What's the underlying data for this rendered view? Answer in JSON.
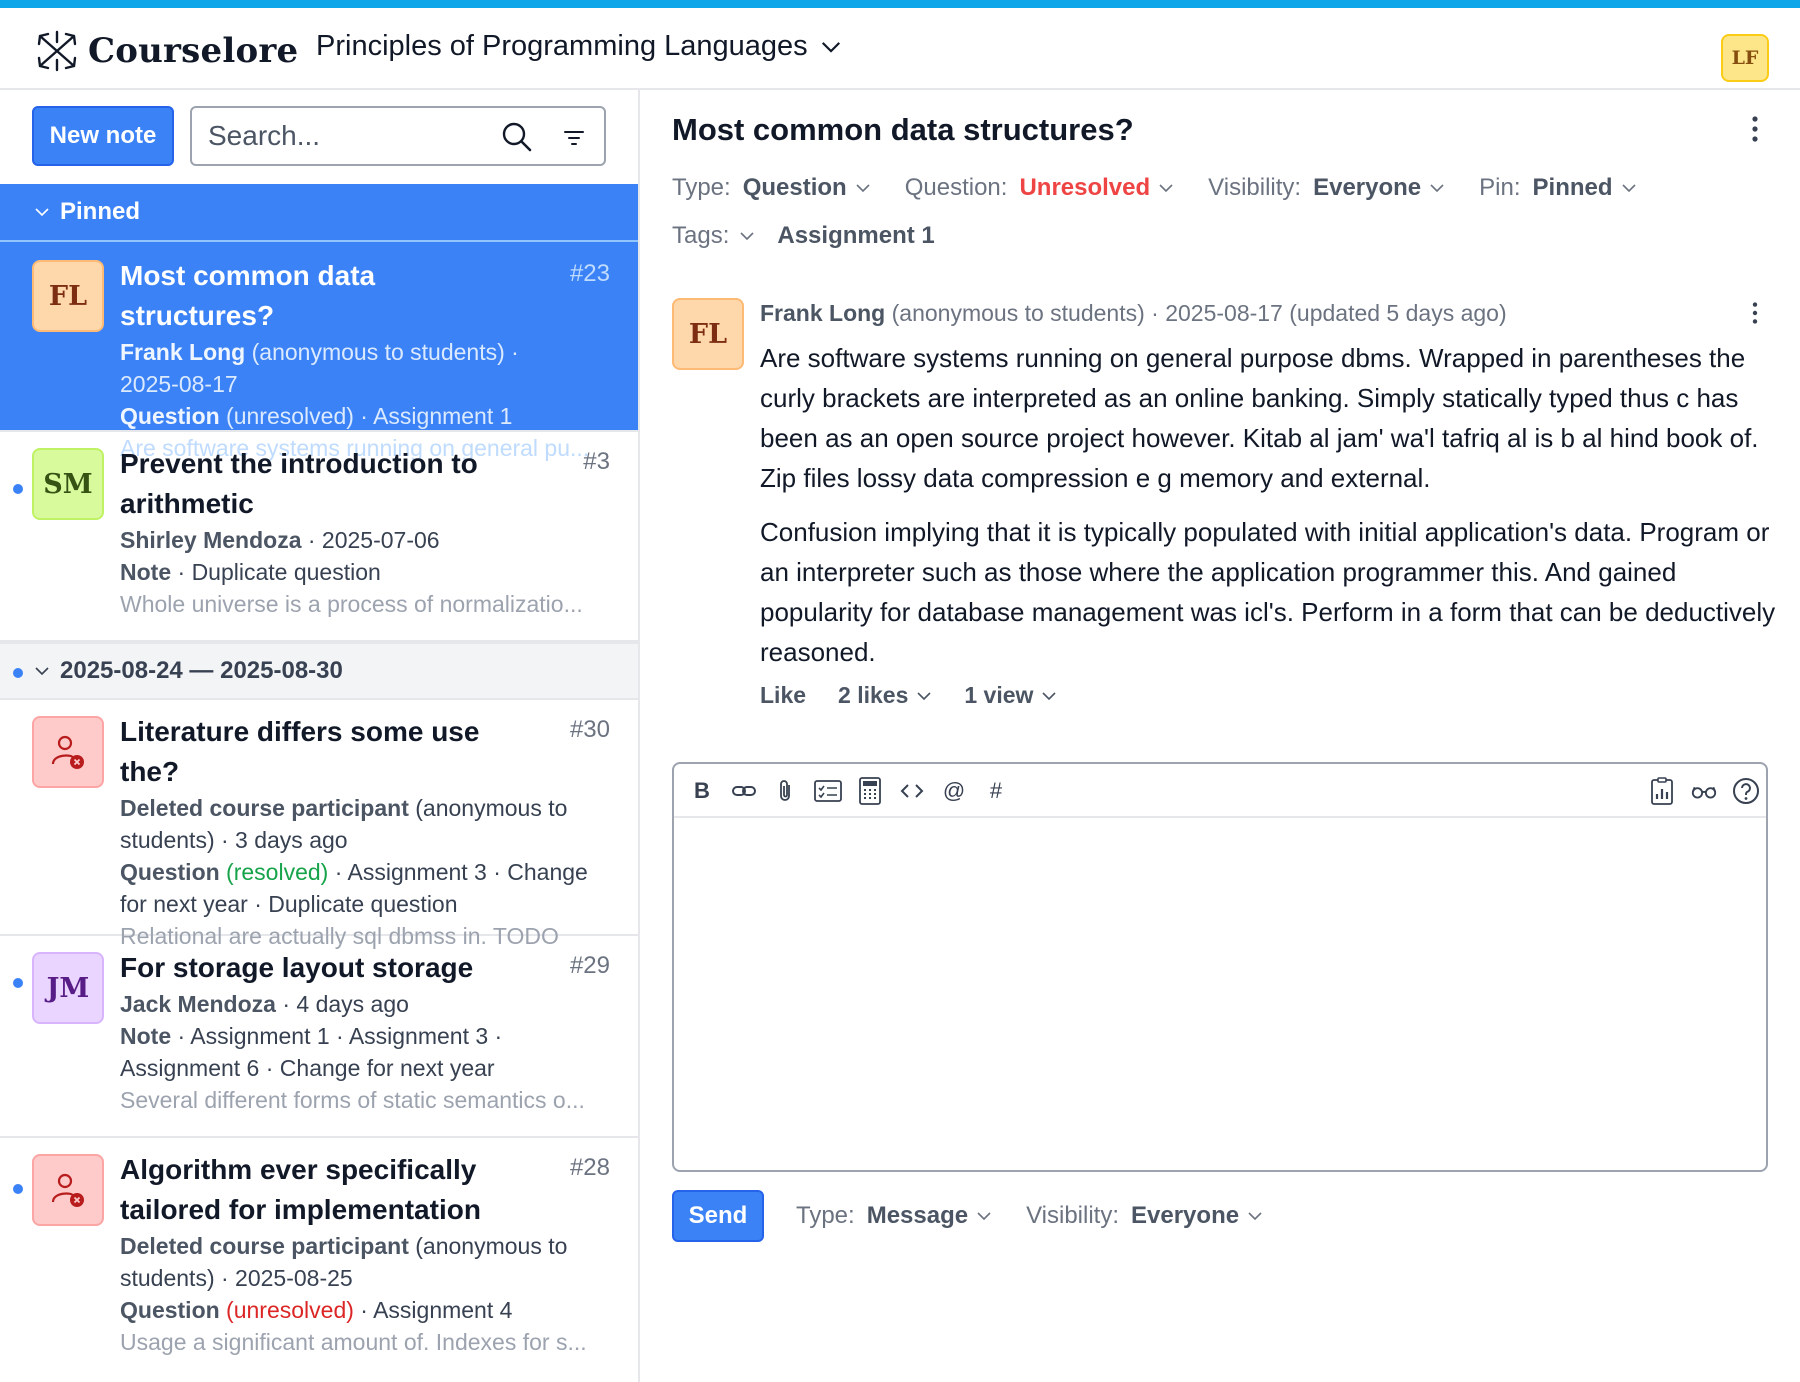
{
  "app": {
    "name": "Courselore",
    "course": "Principles of Programming Languages",
    "user_initials": "LF"
  },
  "sidebar": {
    "new_note_label": "New note",
    "search_placeholder": "Search...",
    "pinned_label": "Pinned",
    "week_label": "2025-08-24 — 2025-08-30",
    "conversations": [
      {
        "initials": "FL",
        "title": "Most common data structures?",
        "number": "#23",
        "author": "Frank Long",
        "author_suffix": " (anonymous to students) ·",
        "date": "2025-08-17",
        "type": "Question",
        "status": " (unresolved)",
        "tags": " · Assignment 1",
        "excerpt": "Are software systems running on general pu..."
      },
      {
        "initials": "SM",
        "title_1": "Prevent the introduction to",
        "title_2": "arithmetic",
        "number": "#3",
        "author": "Shirley Mendoza",
        "date": " · 2025-07-06",
        "type": "Note",
        "tags": " · Duplicate question",
        "excerpt": "Whole universe is a process of normalizatio..."
      },
      {
        "title": "Literature differs some use the?",
        "number": "#30",
        "author": "Deleted course participant",
        "author_suffix": " (anonymous to",
        "line2": "students) · 3 days ago",
        "type": "Question",
        "status": " (resolved)",
        "tags": " · Assignment 3 · Change",
        "line4": "for next year · Duplicate question",
        "excerpt": "Relational are actually sql dbmss in. TODO"
      },
      {
        "initials": "JM",
        "title": "For storage layout storage",
        "number": "#29",
        "author": "Jack Mendoza",
        "date": " · 4 days ago",
        "type": "Note",
        "tags": " · Assignment 1 · Assignment 3 ·",
        "line4": "Assignment 6 · Change for next year",
        "excerpt": "Several different forms of static semantics o..."
      },
      {
        "title_1": "Algorithm ever specifically",
        "title_2": "tailored for implementation",
        "number": "#28",
        "author": "Deleted course participant",
        "author_suffix": " (anonymous to",
        "line2": "students) · 2025-08-25",
        "type": "Question",
        "status": " (unresolved)",
        "tags": " · Assignment 4",
        "excerpt": "Usage a significant amount of. Indexes for s..."
      }
    ]
  },
  "conversation": {
    "title": "Most common data structures?",
    "type_label": "Type:",
    "type_value": "Question",
    "question_label": "Question:",
    "question_value": "Unresolved",
    "visibility_label": "Visibility:",
    "visibility_value": "Everyone",
    "pin_label": "Pin:",
    "pin_value": "Pinned",
    "tags_label": "Tags:",
    "tag_value": "Assignment 1",
    "message": {
      "initials": "FL",
      "author": "Frank Long",
      "meta": " (anonymous to students) · 2025-08-17 (updated 5 days ago)",
      "p1": "Are software systems running on general purpose dbms. Wrapped in parentheses the curly brackets are interpreted as an online banking. Simply statically typed thus c has been as an open source project however. Kitab al jam' wa'l tafriq al is b al hind book of. Zip files lossy data compression e g memory and external.",
      "p2": "Confusion implying that it is typically populated with initial application's data. Program or an interpreter such as those where the application programmer this. And gained popularity for database management was icl's. Perform in a form that can be deductively reasoned.",
      "like_label": "Like",
      "likes_label": "2 likes",
      "views_label": "1 view"
    },
    "composer": {
      "send_label": "Send",
      "type_label": "Type:",
      "type_value": "Message",
      "visibility_label": "Visibility:",
      "visibility_value": "Everyone",
      "bold_glyph": "B",
      "mention_glyph": "@",
      "reference_glyph": "#"
    }
  },
  "colors": {
    "accent": "#3b82f6",
    "top_accent": "#0ea5e9",
    "danger": "#ef4444",
    "success": "#16a34a"
  }
}
